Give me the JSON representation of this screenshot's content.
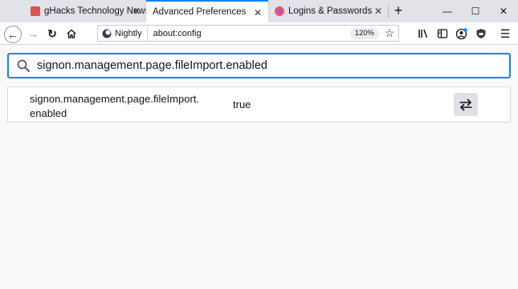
{
  "tabs": [
    {
      "label": "gHacks Technology News",
      "close": "✕",
      "active": false
    },
    {
      "label": "Advanced Preferences",
      "close": "✕",
      "active": true
    },
    {
      "label": "Logins & Passwords",
      "close": "✕",
      "active": false
    }
  ],
  "tabstrip": {
    "new_tab": "+",
    "minimize": "—",
    "maximize": "☐",
    "close": "✕"
  },
  "navbar": {
    "back_icon": "←",
    "forward_icon": "→",
    "reload_icon": "↻",
    "identity_label": "Nightly",
    "url": "about:config",
    "zoom": "120%",
    "bookmark_icon": "☆",
    "menu_icon": "☰"
  },
  "search": {
    "value": "signon.management.page.fileImport.enabled"
  },
  "preferences": [
    {
      "name": "signon.management.page.fileImport.enabled",
      "value": "true"
    }
  ],
  "colors": {
    "accent": "#0a84ff",
    "tab_strip": "#e1e3e8",
    "content_bg": "#f9f9fb"
  }
}
